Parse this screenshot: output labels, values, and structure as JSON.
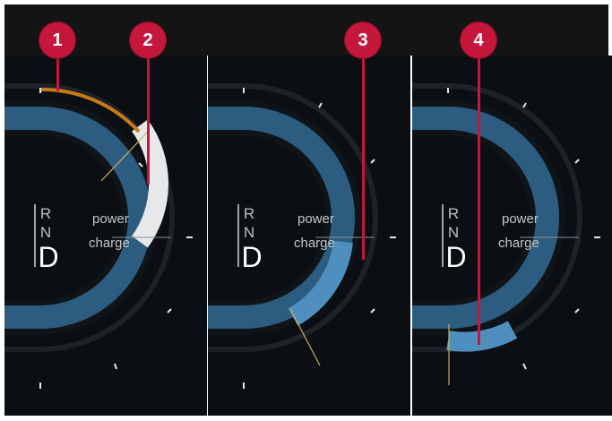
{
  "callouts": [
    "1",
    "2",
    "3",
    "4"
  ],
  "panels": [
    {
      "gear_rn": [
        "R",
        "N"
      ],
      "gear_d": "D",
      "power_label": "power",
      "charge_label": "charge",
      "state": "power-output-with-charge-limit",
      "power_fraction": 0.38
    },
    {
      "gear_rn": [
        "R",
        "N"
      ],
      "gear_d": "D",
      "power_label": "power",
      "charge_label": "charge",
      "state": "charge-regeneration",
      "charge_fraction": 0.62
    },
    {
      "gear_rn": [
        "R",
        "N"
      ],
      "gear_d": "D",
      "power_label": "power",
      "charge_label": "charge",
      "state": "charge-segment-limited",
      "charge_fraction": 0.9
    }
  ],
  "colors": {
    "callout": "#c5163c",
    "arc_blue": "#2c5d80",
    "arc_white": "#e6e8ea",
    "arc_orange": "#c87a17",
    "needle": "#c7b257"
  }
}
